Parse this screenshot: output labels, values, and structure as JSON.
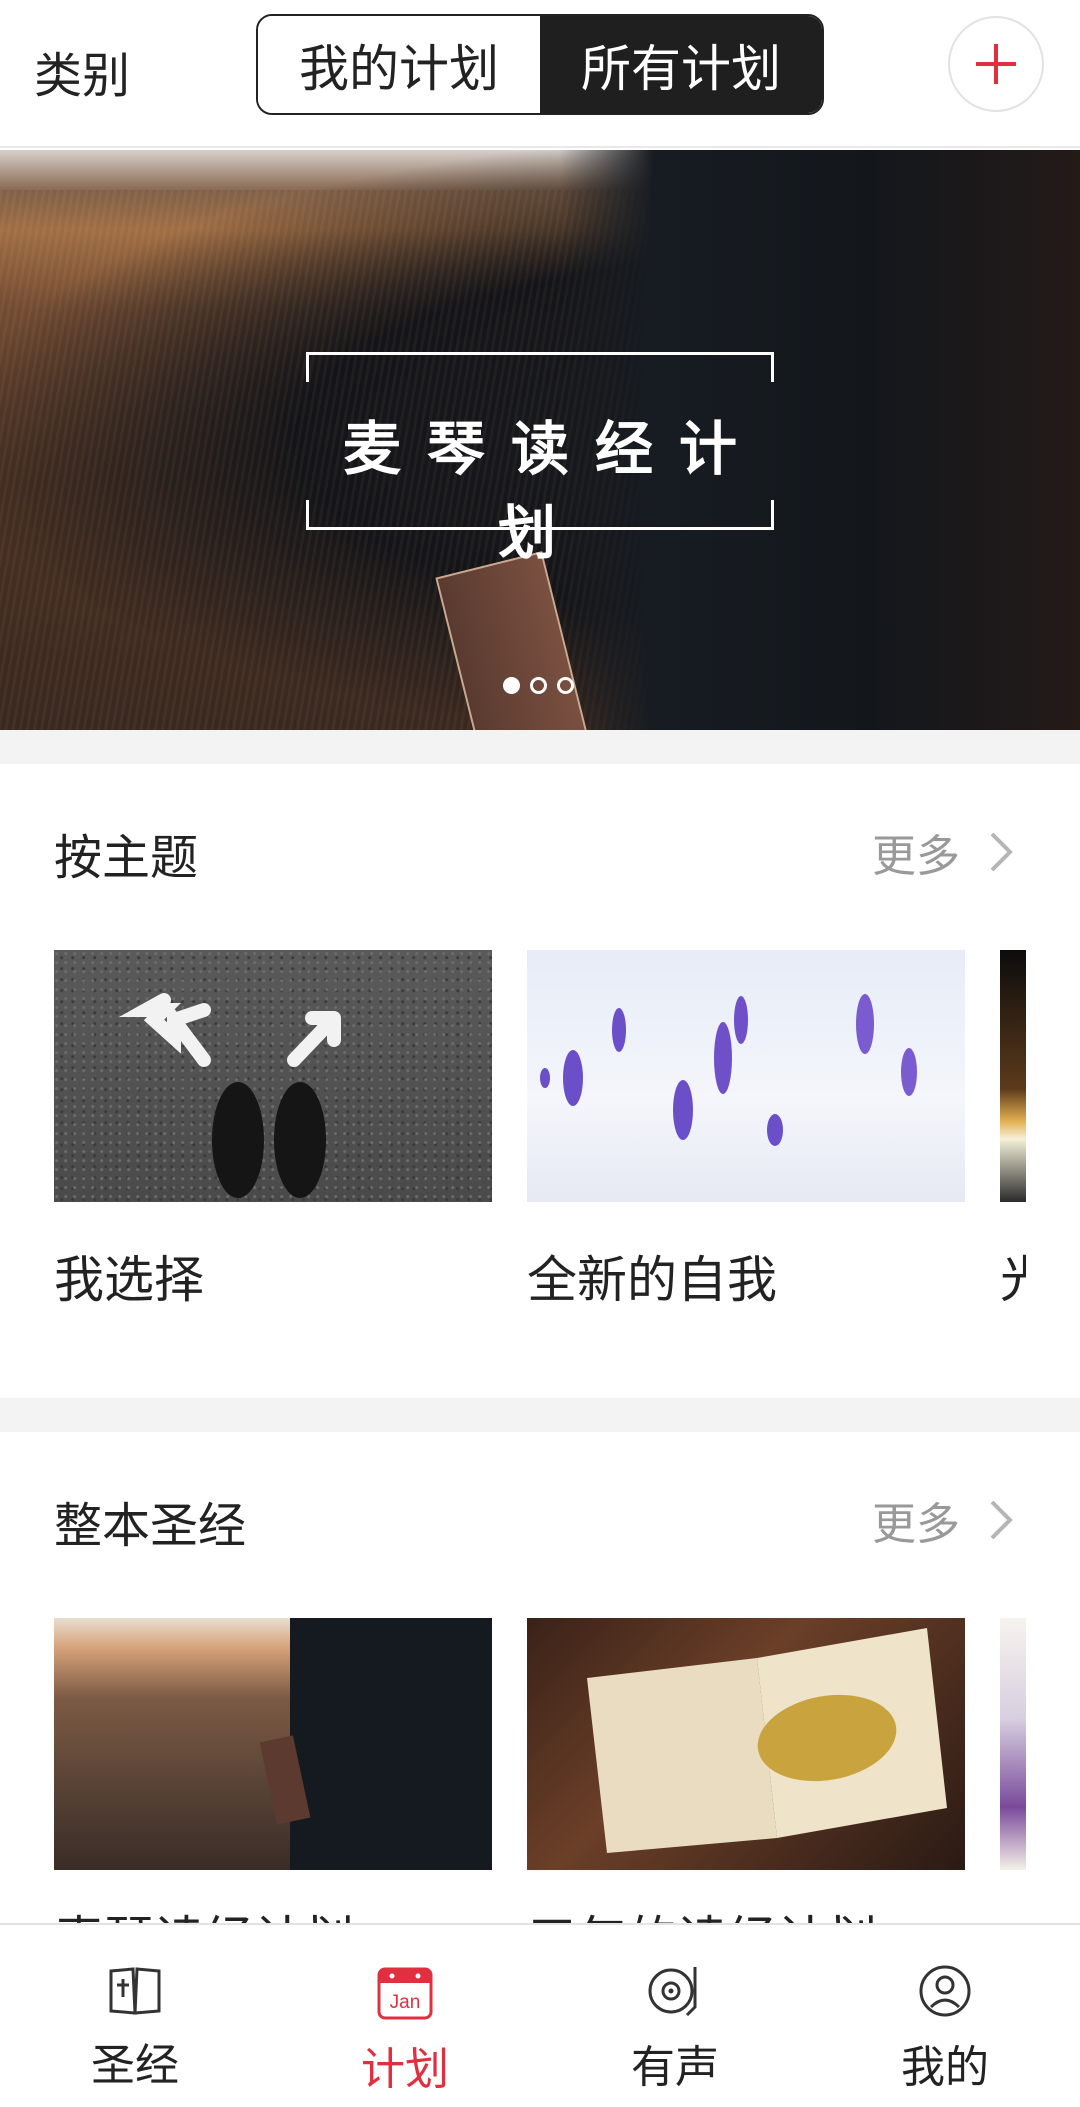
{
  "header": {
    "category_label": "类别",
    "tabs": [
      {
        "label": "我的计划",
        "active": false
      },
      {
        "label": "所有计划",
        "active": true
      }
    ],
    "add_icon": "plus-icon"
  },
  "banner": {
    "title": "麦琴读经计划",
    "slides_total": 3,
    "current_slide": 1
  },
  "sections": [
    {
      "title": "按主题",
      "more_label": "更多",
      "cards": [
        {
          "title": "我选择"
        },
        {
          "title": "全新的自我"
        },
        {
          "title": "光"
        }
      ]
    },
    {
      "title": "整本圣经",
      "more_label": "更多",
      "cards": [
        {
          "title": "麦琴读经计划"
        },
        {
          "title": "三年的读经计划"
        },
        {
          "title": "…"
        }
      ]
    }
  ],
  "bottom_nav": {
    "items": [
      {
        "label": "圣经",
        "icon": "bible-icon",
        "active": false
      },
      {
        "label": "计划",
        "icon": "calendar-icon",
        "active": true,
        "icon_text": "Jan"
      },
      {
        "label": "有声",
        "icon": "audio-disc-icon",
        "active": false
      },
      {
        "label": "我的",
        "icon": "user-icon",
        "active": false
      }
    ]
  },
  "colors": {
    "accent": "#e0303f",
    "segment_active_bg": "#1f1f1f",
    "muted_text": "#999999"
  }
}
